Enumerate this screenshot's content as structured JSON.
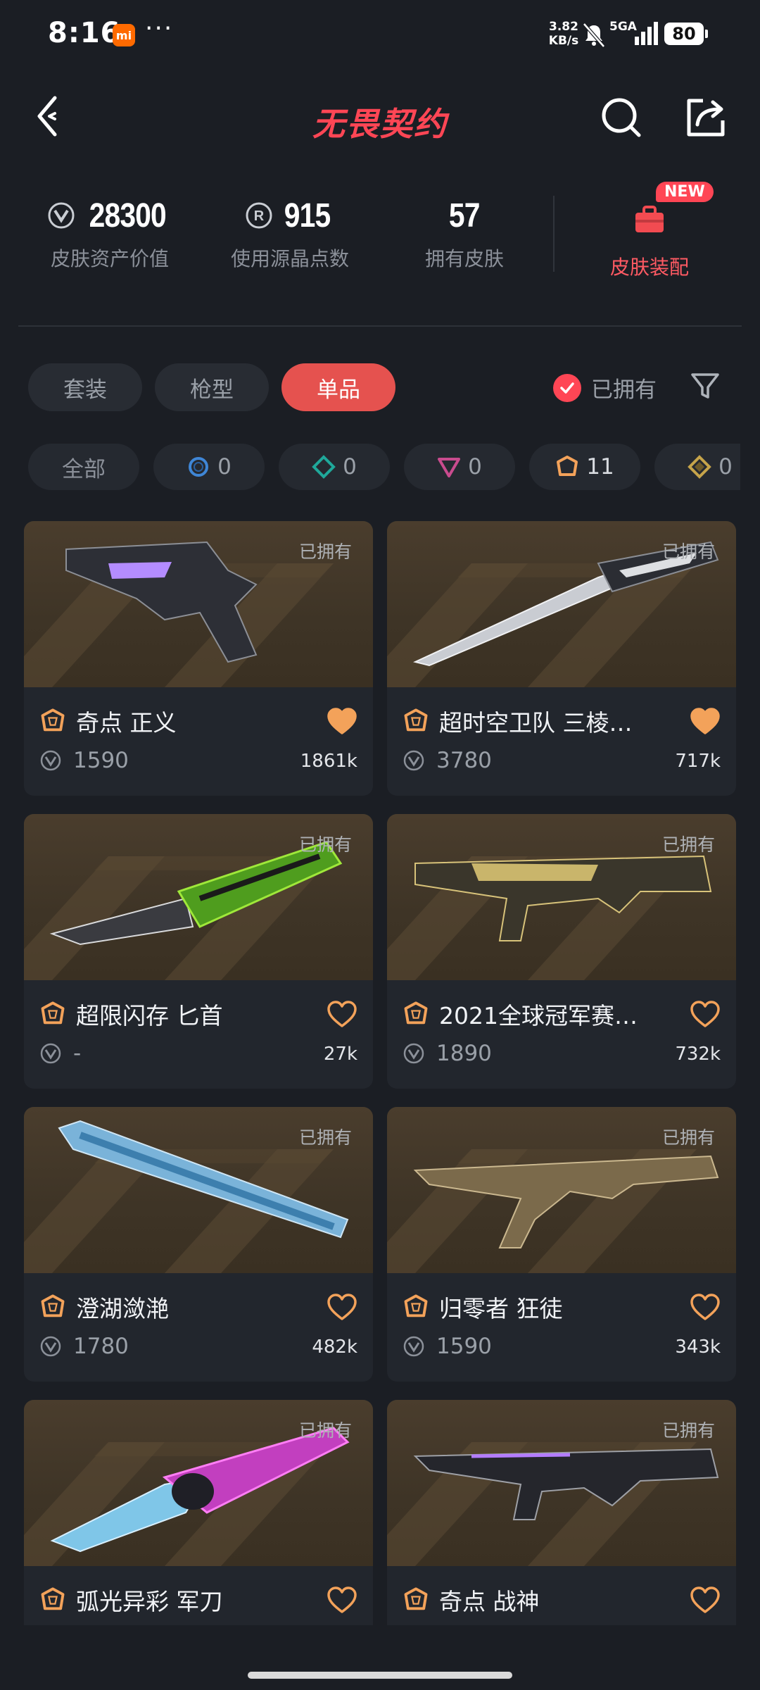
{
  "status_bar": {
    "time": "8:16",
    "app_badge": "mi",
    "more": "···",
    "speed_value": "3.82",
    "speed_unit": "KB/s",
    "network": "5GA",
    "battery": "80"
  },
  "header": {
    "title": "无畏契约",
    "back_icon": "back-arrow-icon",
    "search_icon": "search-icon",
    "share_icon": "share-icon"
  },
  "stats": {
    "asset_value": {
      "value": "28300",
      "label": "皮肤资产价值",
      "icon": "vp-coin-icon"
    },
    "radianite": {
      "value": "915",
      "label": "使用源晶点数",
      "icon": "radianite-icon"
    },
    "owned_skins": {
      "value": "57",
      "label": "拥有皮肤"
    },
    "outfit": {
      "label": "皮肤装配",
      "badge": "NEW",
      "icon": "briefcase-icon"
    }
  },
  "tabs": [
    {
      "label": "套装",
      "active": false
    },
    {
      "label": "枪型",
      "active": false
    },
    {
      "label": "单品",
      "active": true
    }
  ],
  "owned_filter": {
    "label": "已拥有",
    "checked": true
  },
  "filter_icon": "funnel-icon",
  "tiers": [
    {
      "label": "全部",
      "count": ""
    },
    {
      "label": "",
      "count": "0",
      "icon": "select-tier-icon",
      "color": "#3f86d6"
    },
    {
      "label": "",
      "count": "0",
      "icon": "deluxe-tier-icon",
      "color": "#1fa89a"
    },
    {
      "label": "",
      "count": "0",
      "icon": "premium-tier-icon",
      "color": "#c94b8e"
    },
    {
      "label": "",
      "count": "11",
      "icon": "ultra-tier-icon",
      "color": "#f3a25a"
    },
    {
      "label": "",
      "count": "0",
      "icon": "exclusive-tier-icon",
      "color": "#c6a44a"
    }
  ],
  "owned_badge": "已拥有",
  "cards": [
    {
      "name": "奇点 正义",
      "price": "1590",
      "likes": "1861k",
      "liked": true
    },
    {
      "name": "超时空卫队 三棱…",
      "price": "3780",
      "likes": "717k",
      "liked": true
    },
    {
      "name": "超限闪存 匕首",
      "price": "-",
      "likes": "27k",
      "liked": false
    },
    {
      "name": "2021全球冠军赛…",
      "price": "1890",
      "likes": "732k",
      "liked": false
    },
    {
      "name": "澄湖潋滟",
      "price": "1780",
      "likes": "482k",
      "liked": false
    },
    {
      "name": "归零者 狂徒",
      "price": "1590",
      "likes": "343k",
      "liked": false
    },
    {
      "name": "弧光异彩 军刀",
      "price": "",
      "likes": "",
      "liked": false
    },
    {
      "name": "奇点 战神",
      "price": "",
      "likes": "",
      "liked": false
    }
  ],
  "colors": {
    "accent": "#ff4655",
    "background": "#1b1e24",
    "card": "#22262d",
    "heart": "#f3a25a"
  }
}
